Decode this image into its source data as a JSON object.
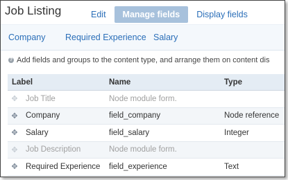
{
  "page": {
    "title": "Job Listing"
  },
  "top_tabs": [
    {
      "label": "Edit",
      "active": false
    },
    {
      "label": "Manage fields",
      "active": true
    },
    {
      "label": "Display fields",
      "active": false
    }
  ],
  "sub_tabs": [
    {
      "label": "Company"
    },
    {
      "label": "Required Experience"
    },
    {
      "label": "Salary"
    }
  ],
  "help_text": "Add fields and groups to the content type, and arrange them on content dis",
  "table": {
    "headers": [
      "Label",
      "Name",
      "Type"
    ],
    "rows": [
      {
        "label": "Job Title",
        "name": "Node module form.",
        "type": "",
        "disabled": true
      },
      {
        "label": "Company",
        "name": "field_company",
        "type": "Node reference",
        "disabled": false
      },
      {
        "label": "Salary",
        "name": "field_salary",
        "type": "Integer",
        "disabled": false
      },
      {
        "label": "Job Description",
        "name": "Node module form.",
        "type": "",
        "disabled": true
      },
      {
        "label": "Required Experience",
        "name": "field_experience",
        "type": "Text",
        "disabled": false
      }
    ]
  },
  "icons": {
    "drag": "drag-handle-icon",
    "help": "help-icon"
  },
  "colors": {
    "link": "#2a6eb8",
    "active_tab_bg": "#a7c1dc",
    "header_bg": "#e4ecf4"
  }
}
